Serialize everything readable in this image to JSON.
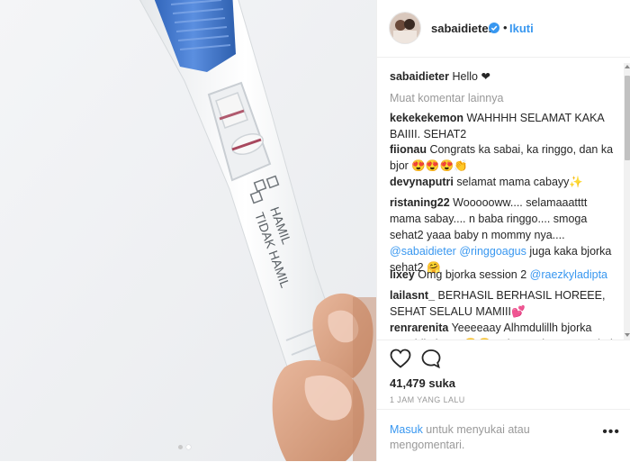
{
  "post": {
    "username": "sabaidieter",
    "dot": "•",
    "follow_label": "Ikuti",
    "caption_user": "sabaidieter",
    "caption_text": "Hello ❤",
    "load_more": "Muat komentar lainnya",
    "image_labels": {
      "hamil": "HAMIL",
      "tidak_hamil": "TIDAK HAMIL"
    },
    "carousel": {
      "count": 2,
      "active": 1
    }
  },
  "comments": [
    {
      "user": "kekekekemon",
      "text": "WAHHHH SELAMAT KAKA BAIIII. SEHAT2"
    },
    {
      "user": "fiionau",
      "text": "Congrats ka sabai, ka ringgo, dan ka bjor 😍😍😍👏"
    },
    {
      "user": "devynaputri",
      "text": "selamat mama cabayy✨"
    },
    {
      "user": "ristaning22",
      "text": "Woooooww.... selamaaatttt mama sabay.... n baba ringgo.... smoga sehat2 yaaa baby n mommy nya....",
      "mention1": "@sabaidieter",
      "mention2": "@ringgoagus",
      "text2": "juga kaka bjorka sehat2 🤗"
    },
    {
      "user": "lixey",
      "text": "Omg bjorka session 2",
      "mention1": "@raezkyladipta"
    },
    {
      "user": "lailasnt_",
      "text": "BERHASIL BERHASIL HOREEE, SEHAT SELALU MAMIII💕"
    },
    {
      "user": "renrarenita",
      "text": "Yeeeeaay Alhmdulillh bjorka mau jdi abang 😍😍\"sehat\" yah mama sabai"
    }
  ],
  "actions": {
    "heart_icon": "heart-outline",
    "comment_icon": "speech-bubble",
    "likes": "41,479 suka",
    "time": "1 JAM YANG LALU"
  },
  "login": {
    "link": "Masuk",
    "text": " untuk menyukai atau mengomentari.",
    "more": "•••"
  },
  "colors": {
    "link": "#3897f0",
    "muted": "#999999",
    "border": "#efefef"
  }
}
